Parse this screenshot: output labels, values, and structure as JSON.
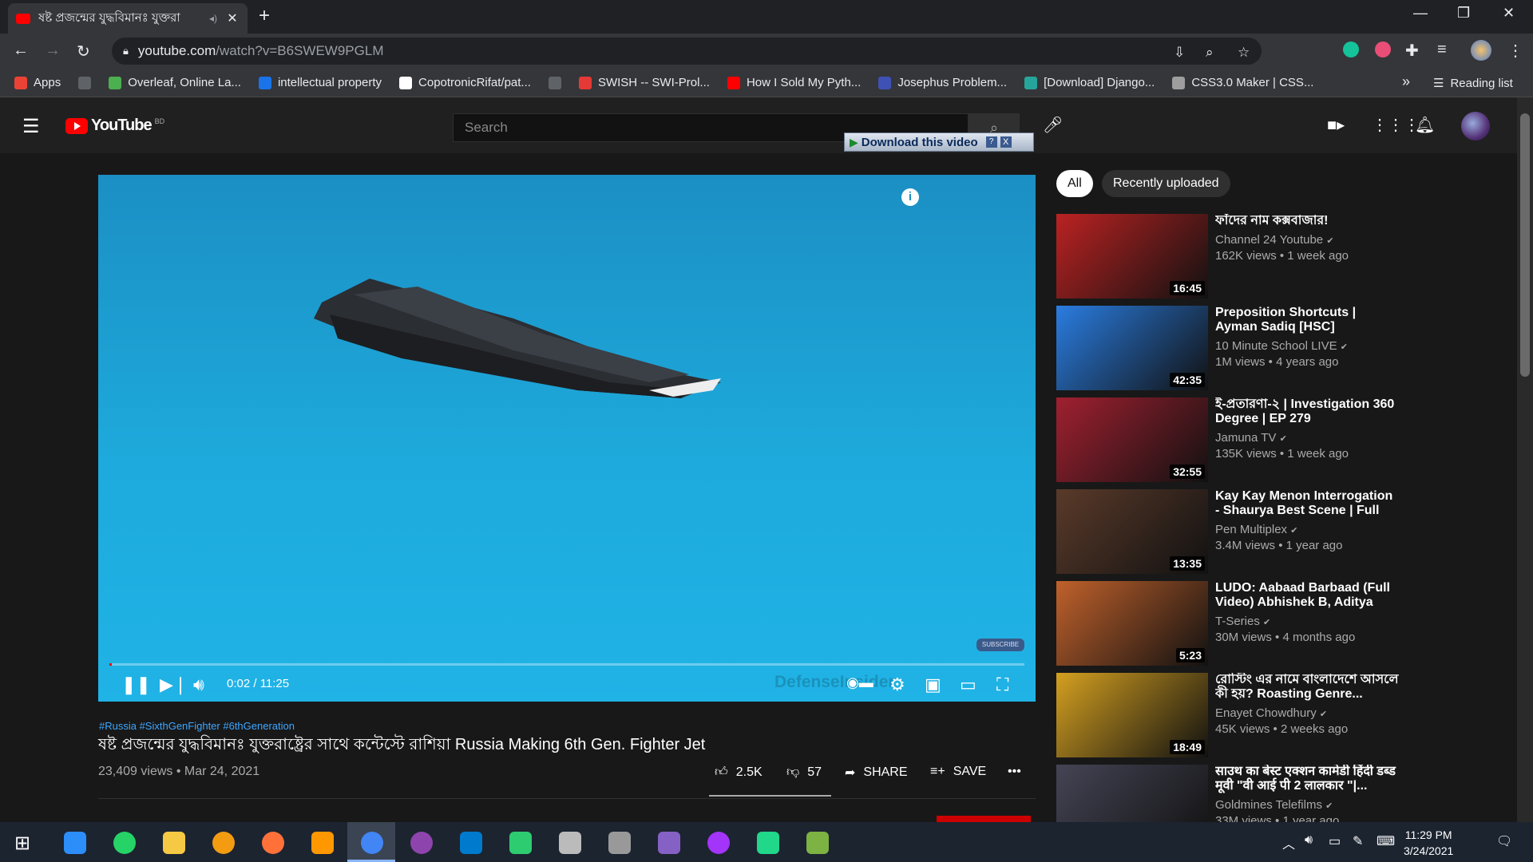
{
  "browser": {
    "tab_title": "ষষ্ট প্রজন্মের যুদ্ধবিমানঃ যুক্তরা",
    "url_host": "youtube.com",
    "url_path": "/watch?v=B6SWEW9PGLM",
    "bookmarks": [
      {
        "label": "Apps",
        "color": "#ea4335"
      },
      {
        "label": "",
        "color": "#5f6368"
      },
      {
        "label": "Overleaf, Online La...",
        "color": "#4caf50"
      },
      {
        "label": "intellectual property",
        "color": "#1a73e8"
      },
      {
        "label": "CopotronicRifat/pat...",
        "color": "#ffffff"
      },
      {
        "label": "",
        "color": "#5f6368"
      },
      {
        "label": "SWISH -- SWI-Prol...",
        "color": "#e53935"
      },
      {
        "label": "How I Sold My Pyth...",
        "color": "#ff0000"
      },
      {
        "label": "Josephus Problem...",
        "color": "#3f51b5"
      },
      {
        "label": "[Download] Django...",
        "color": "#26a69a"
      },
      {
        "label": "CSS3.0 Maker | CSS...",
        "color": "#9e9e9e"
      }
    ],
    "more_label": "»",
    "reading_list": "Reading list"
  },
  "youtube": {
    "logo_text": "YouTube",
    "country_code": "BD",
    "search_placeholder": "Search",
    "download_label": "Download this video",
    "download_help": "?",
    "download_close": "X"
  },
  "player": {
    "time": "0:02 / 11:25",
    "progress": 0.003,
    "subscribe_watermark": "SUBSCRIBE",
    "channel_watermark": "DefenseInsider"
  },
  "video": {
    "tags": "#Russia #SixthGenFighter #6thGeneration",
    "title": "ষষ্ট প্রজন্মের যুদ্ধবিমানঃ যুক্তরাষ্ট্রের সাথে কন্টেস্টে রাশিয়া Russia Making 6th Gen. Fighter Jet",
    "views_date": "23,409 views • Mar 24, 2021",
    "likes": "2.5K",
    "dislikes": "57",
    "share": "SHARE",
    "save": "SAVE"
  },
  "sidebar": {
    "chips": [
      "All",
      "Recently uploaded"
    ],
    "videos": [
      {
        "title": "ফাঁদের নাম কক্সবাজার!",
        "channel": "Channel 24 Youtube",
        "meta": "162K views • 1 week ago",
        "duration": "16:45",
        "thumb_color": "#b22"
      },
      {
        "title": "Preposition Shortcuts | Ayman Sadiq [HSC]",
        "channel": "10 Minute School LIVE",
        "meta": "1M views • 4 years ago",
        "duration": "42:35",
        "thumb_color": "#2a7de1"
      },
      {
        "title": "ই-প্রতারণা-২ | Investigation 360 Degree | EP 279",
        "channel": "Jamuna TV",
        "meta": "135K views • 1 week ago",
        "duration": "32:55",
        "thumb_color": "#a02030"
      },
      {
        "title": "Kay Kay Menon Interrogation - Shaurya Best Scene | Full Hind...",
        "channel": "Pen Multiplex",
        "meta": "3.4M views • 1 year ago",
        "duration": "13:35",
        "thumb_color": "#5a3a2a"
      },
      {
        "title": "LUDO: Aabaad Barbaad (Full Video) Abhishek B, Aditya K,...",
        "channel": "T-Series",
        "meta": "30M views • 4 months ago",
        "duration": "5:23",
        "thumb_color": "#c0612b"
      },
      {
        "title": "রোস্টিং এর নামে বাংলাদেশে আসলে কী হয়? Roasting Genre...",
        "channel": "Enayet Chowdhury",
        "meta": "45K views • 2 weeks ago",
        "duration": "18:49",
        "thumb_color": "#d4a020"
      },
      {
        "title": "साउथ का बेस्ट एक्शन कामेडी हिंदी डब्ड मूवी \"वी आई पी 2 लालकार \"|...",
        "channel": "Goldmines Telefilms",
        "meta": "33M views • 1 year ago",
        "duration": "",
        "thumb_color": "#445"
      }
    ]
  },
  "taskbar": {
    "time": "11:29 PM",
    "date": "3/24/2021",
    "apps": [
      {
        "name": "search",
        "color": "#2c8ef8"
      },
      {
        "name": "whatsapp",
        "color": "#25d366"
      },
      {
        "name": "file-explorer",
        "color": "#f6c945"
      },
      {
        "name": "app-orange",
        "color": "#f39c12"
      },
      {
        "name": "firefox",
        "color": "#ff7139"
      },
      {
        "name": "app-blocks",
        "color": "#ff9800"
      },
      {
        "name": "chrome",
        "color": "#4285f4"
      },
      {
        "name": "github-desktop",
        "color": "#8e44ad"
      },
      {
        "name": "vscode",
        "color": "#007acc"
      },
      {
        "name": "app-globe",
        "color": "#2ecc71"
      },
      {
        "name": "app-sphere",
        "color": "#bbb"
      },
      {
        "name": "app-satellite",
        "color": "#999"
      },
      {
        "name": "visual-studio",
        "color": "#8661c5"
      },
      {
        "name": "messenger",
        "color": "#a334fa"
      },
      {
        "name": "pycharm",
        "color": "#21d789"
      },
      {
        "name": "app-sheet",
        "color": "#7cb342"
      }
    ]
  }
}
